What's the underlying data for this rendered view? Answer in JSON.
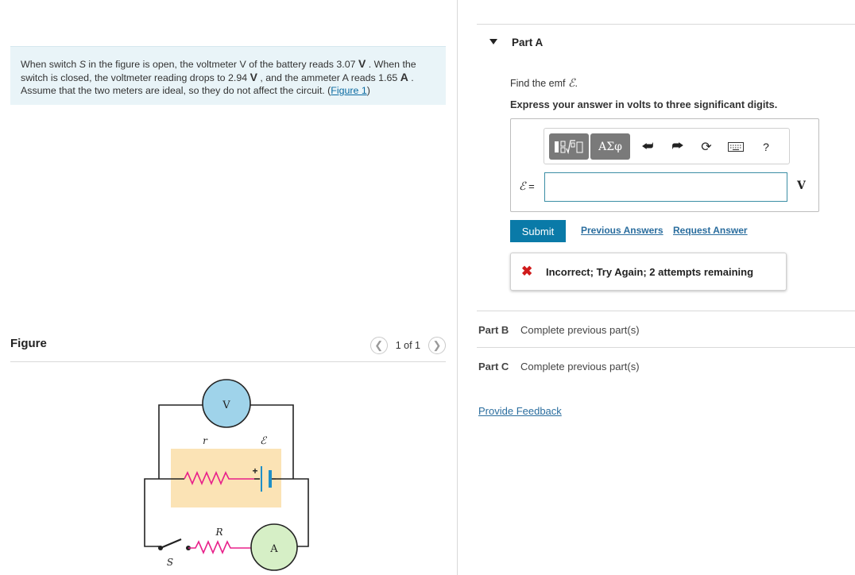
{
  "problem": {
    "t1": "When switch ",
    "switch_var": "S",
    "t2": " in the figure is open, the voltmeter V of the battery reads 3.07 ",
    "unit1": "V",
    "t3": " . When the switch is closed, the voltmeter reading drops to 2.94 ",
    "unit2": "V",
    "t4": " , and the ammeter A reads 1.65 ",
    "unit3": "A",
    "t5": " . Assume that the two meters are ideal, so they do not affect the circuit. (",
    "figure_link": "Figure 1",
    "t6": ")"
  },
  "figure": {
    "title": "Figure",
    "pager_text": "1 of 1",
    "prev_icon": "chevron-left-icon",
    "next_icon": "chevron-right-icon",
    "labels": {
      "voltmeter": "V",
      "ammeter": "A",
      "internal_resistance": "r",
      "emf": "ℰ",
      "plus": "+",
      "resistor": "R",
      "switch": "S"
    }
  },
  "partA": {
    "title": "Part A",
    "find_prefix": "Find the emf ",
    "find_symbol": "ℰ",
    "find_suffix": ".",
    "express": "Express your answer in volts to three significant digits.",
    "toolbar": {
      "templates_icon": "fraction-sqrt-template-icon",
      "greek": "ΑΣφ",
      "undo_icon": "undo-icon",
      "redo_icon": "redo-icon",
      "reset_icon": "reset-icon",
      "keyboard_icon": "keyboard-icon",
      "help": "?"
    },
    "eq_symbol": "ℰ",
    "eq_sign": " =",
    "input_value": "",
    "unit": "V",
    "submit": "Submit",
    "previous_answers": "Previous Answers",
    "request_answer": "Request Answer",
    "feedback_icon": "✖",
    "feedback": "Incorrect; Try Again; 2 attempts remaining"
  },
  "partB": {
    "label": "Part B",
    "status": "Complete previous part(s)"
  },
  "partC": {
    "label": "Part C",
    "status": "Complete previous part(s)"
  },
  "provide_feedback": "Provide Feedback",
  "colors": {
    "problem_bg": "#e9f4f8",
    "voltmeter": "#9fd3ea",
    "ammeter": "#d6efc6",
    "battery_box": "#fbe3b5",
    "resistor": "#e8208a",
    "battery_plate": "#1e8fc7",
    "submit": "#0a7aa8",
    "link": "#2a6d9e",
    "error": "#d01b1b"
  }
}
